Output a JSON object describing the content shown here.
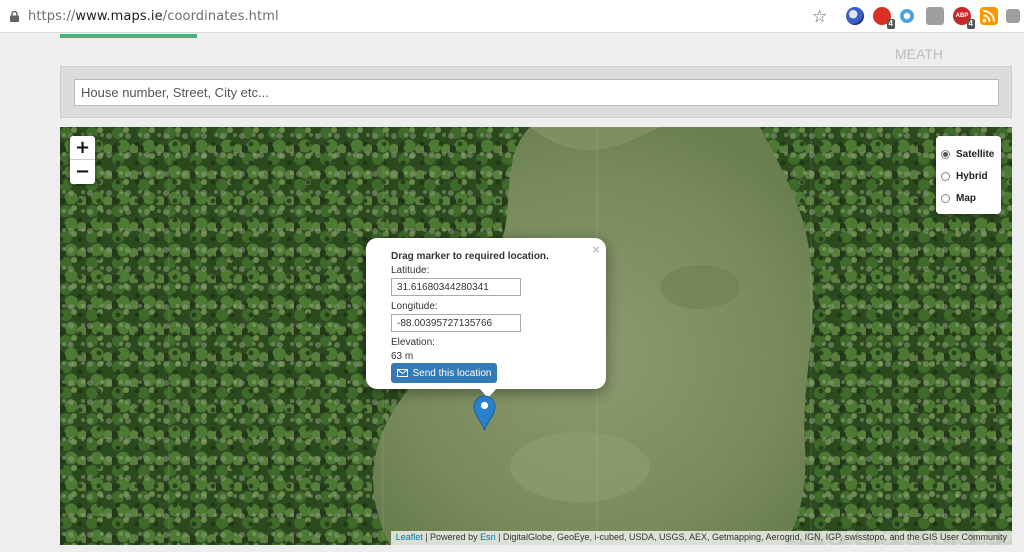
{
  "browser": {
    "url_scheme": "https://",
    "url_host": "www.maps.ie",
    "url_path": "/coordinates.html",
    "badges": {
      "ext2": "4",
      "ext6": "4"
    },
    "abp_label": "ABP"
  },
  "colors": {
    "accent_green": "#4caf7c",
    "button_blue": "#337ab7",
    "link_blue": "#0078a8"
  },
  "background_labels": [
    "MEATH"
  ],
  "search": {
    "placeholder": "House number, Street, City etc..."
  },
  "map": {
    "zoom_in": "+",
    "zoom_out": "−",
    "layers": [
      {
        "label": "Satellite",
        "selected": true
      },
      {
        "label": "Hybrid",
        "selected": false
      },
      {
        "label": "Map",
        "selected": false
      }
    ],
    "popup": {
      "close": "×",
      "title": "Drag marker to required location.",
      "latitude_label": "Latitude:",
      "latitude_value": "31.61680344280341",
      "longitude_label": "Longitude:",
      "longitude_value": "-88.00395727135766",
      "elevation_label": "Elevation:",
      "elevation_value": "63 m",
      "send_button": "Send this location"
    },
    "attribution": {
      "leaflet": "Leaflet",
      "sep1": " | Powered by ",
      "esri": "Esri",
      "rest": " | DigitalGlobe, GeoEye, i-cubed, USDA, USGS, AEX, Getmapping, Aerogrid, IGN, IGP, swisstopo, and the GIS User Community"
    }
  }
}
